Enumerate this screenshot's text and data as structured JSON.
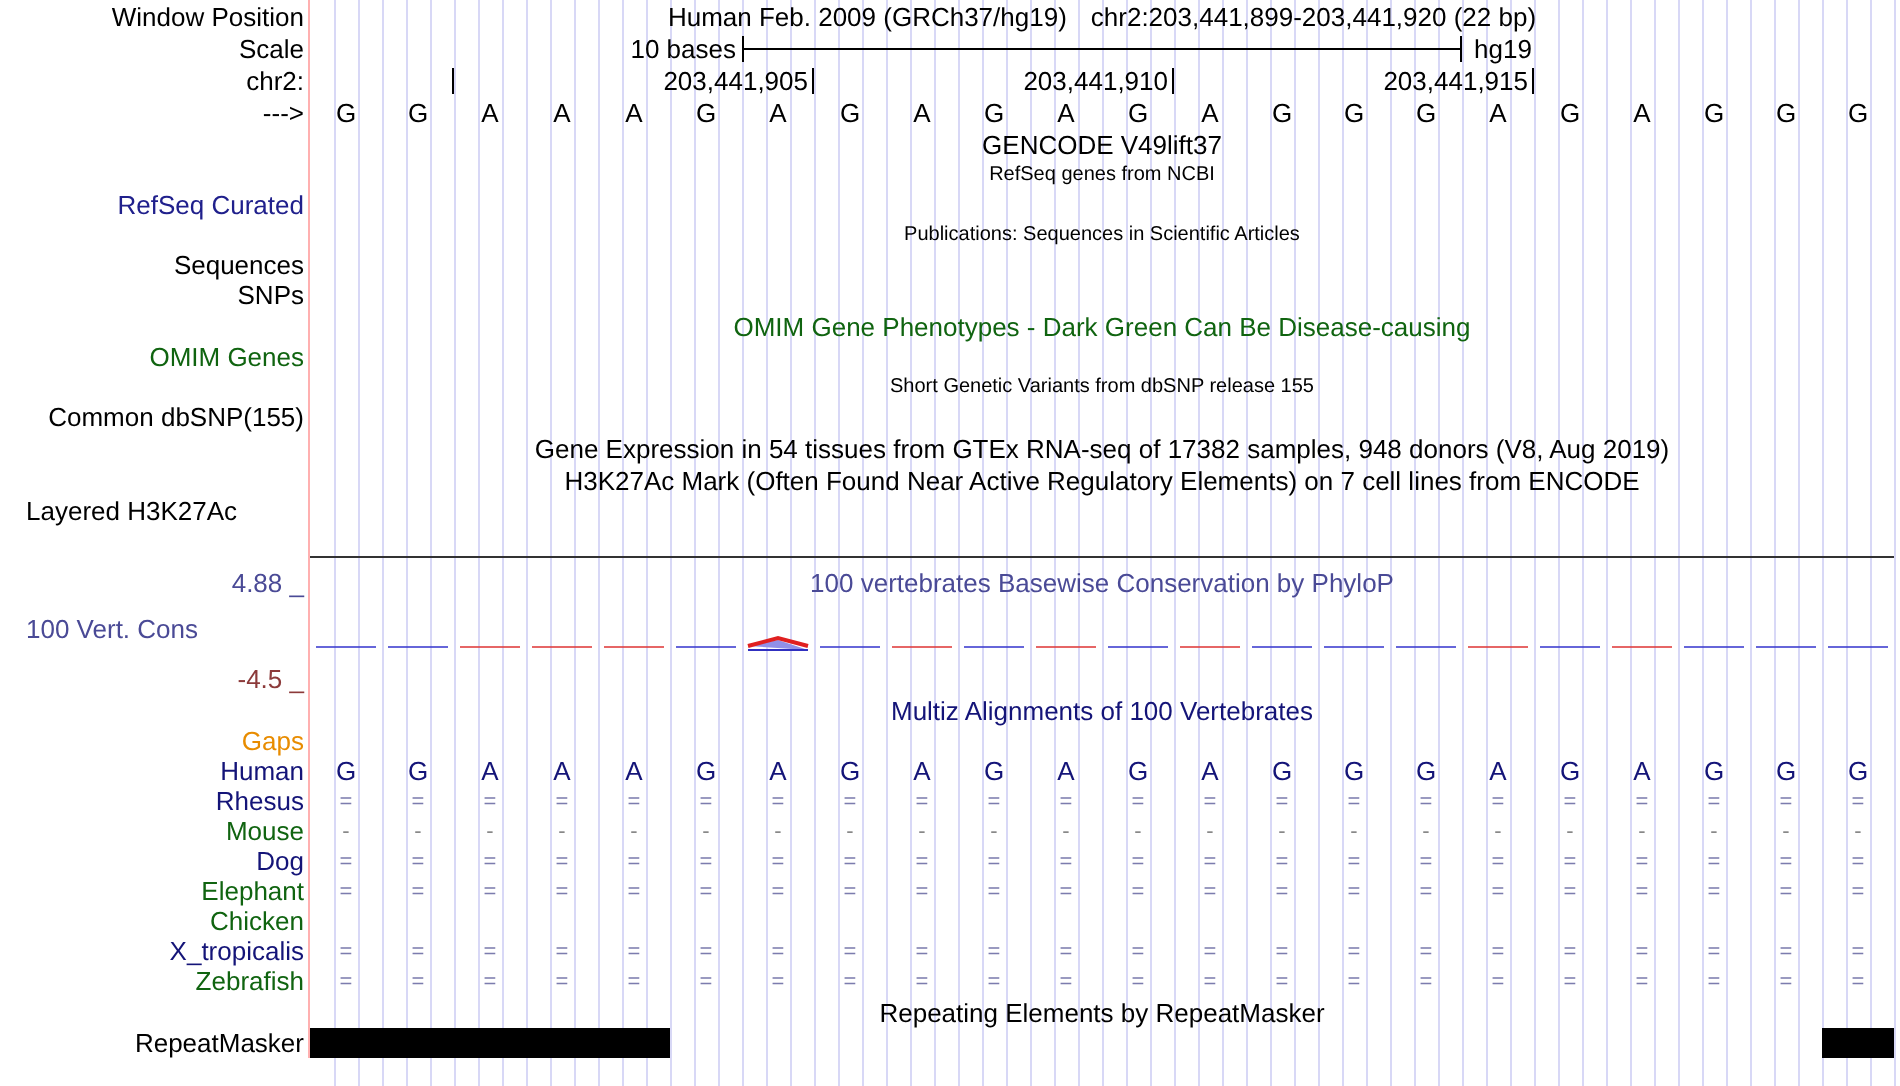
{
  "rows": [
    {
      "kind": "title",
      "label": "Window Position",
      "color": "#000000",
      "title": "Human Feb. 2009 (GRCh37/hg19)",
      "position": "chr2:203,441,899-203,441,920 (22 bp)"
    },
    {
      "kind": "scale",
      "label": "Scale",
      "color": "#000000",
      "span": "10 bases",
      "assembly": "hg19"
    },
    {
      "kind": "ruler",
      "label": "chr2:",
      "color": "#000000",
      "tick_labels": [
        "203,441,905",
        "203,441,910",
        "203,441,915"
      ]
    },
    {
      "kind": "sequence",
      "label": "--->",
      "color": "#000000",
      "bases": "G G A A A G A G A G A G A G G G A G A G G G"
    },
    {
      "kind": "caption",
      "text": "GENCODE V49lift37",
      "color": "#000000"
    },
    {
      "kind": "small_caption",
      "text": "RefSeq genes from NCBI",
      "color": "#000000"
    },
    {
      "kind": "label",
      "label": "RefSeq Curated",
      "color": "#20208c"
    },
    {
      "kind": "small_caption",
      "text": "Publications: Sequences in Scientific Articles",
      "color": "#000000"
    },
    {
      "kind": "label",
      "label": "Sequences",
      "color": "#000000"
    },
    {
      "kind": "label",
      "label": "SNPs",
      "color": "#000000"
    },
    {
      "kind": "caption",
      "text": "OMIM Gene Phenotypes - Dark Green Can Be Disease-causing",
      "color": "#106410"
    },
    {
      "kind": "label",
      "label": "OMIM Genes",
      "color": "#106410"
    },
    {
      "kind": "small_caption",
      "text": "Short Genetic Variants from dbSNP release 155",
      "color": "#000000"
    },
    {
      "kind": "label",
      "label": "Common dbSNP(155)",
      "color": "#000000"
    },
    {
      "kind": "caption",
      "text": "Gene Expression in 54 tissues from GTEx RNA-seq of 17382 samples, 948 donors (V8, Aug 2019)",
      "color": "#000000"
    },
    {
      "kind": "caption",
      "text": "H3K27Ac Mark (Often Found Near Active Regulatory Elements) on 7 cell lines from ENCODE",
      "color": "#000000"
    },
    {
      "kind": "group_label",
      "label": "Layered H3K27Ac",
      "color": "#000000"
    },
    {
      "kind": "divider"
    },
    {
      "kind": "caption",
      "label": "4.88 _",
      "text": "100 vertebrates Basewise Conservation by PhyloP",
      "color": "#4a4a96"
    },
    {
      "kind": "wiggle",
      "label": "100 Vert. Cons",
      "color": "#4a4a96"
    },
    {
      "kind": "label",
      "label": "-4.5 _",
      "color": "#8c3a3a"
    },
    {
      "kind": "caption",
      "text": "Multiz Alignments of 100 Vertebrates",
      "color": "#141478"
    },
    {
      "kind": "label",
      "label": "Gaps",
      "color": "#e88c00"
    },
    {
      "kind": "reference",
      "label": "Human",
      "color": "#141478",
      "bases": "G G A A A G A G A G A G A G G G A G A G G G"
    },
    {
      "kind": "alignment",
      "label": "Rhesus",
      "color": "#141478",
      "bases": "= = = = = = = = = = = = = = = = = = = = = ="
    },
    {
      "kind": "alignment",
      "label": "Mouse",
      "color": "#106410",
      "bases": "- - - - - - - - - - - - - - - - - - - - - -"
    },
    {
      "kind": "alignment",
      "label": "Dog",
      "color": "#141478",
      "bases": "= = = = = = = = = = = = = = = = = = = = = ="
    },
    {
      "kind": "alignment",
      "label": "Elephant",
      "color": "#106410",
      "bases": "= = = = = = = = = = = = = = = = = = = = = ="
    },
    {
      "kind": "alignment",
      "label": "Chicken",
      "color": "#106410"
    },
    {
      "kind": "alignment",
      "label": "X_tropicalis",
      "color": "#141478",
      "bases": "= = = = = = = = = = = = = = = = = = = = = ="
    },
    {
      "kind": "alignment",
      "label": "Zebrafish",
      "color": "#106410",
      "bases": "= = = = = = = = = = = = = = = = = = = = = ="
    },
    {
      "kind": "caption",
      "text": "Repeating Elements by RepeatMasker",
      "color": "#000000"
    },
    {
      "kind": "repeat",
      "label": "RepeatMasker",
      "color": "#000000",
      "masked": [
        true,
        true,
        true,
        true,
        true,
        false,
        false,
        false,
        false,
        false,
        false,
        false,
        false,
        false,
        false,
        false,
        false,
        false,
        false,
        false,
        false,
        true
      ]
    }
  ]
}
